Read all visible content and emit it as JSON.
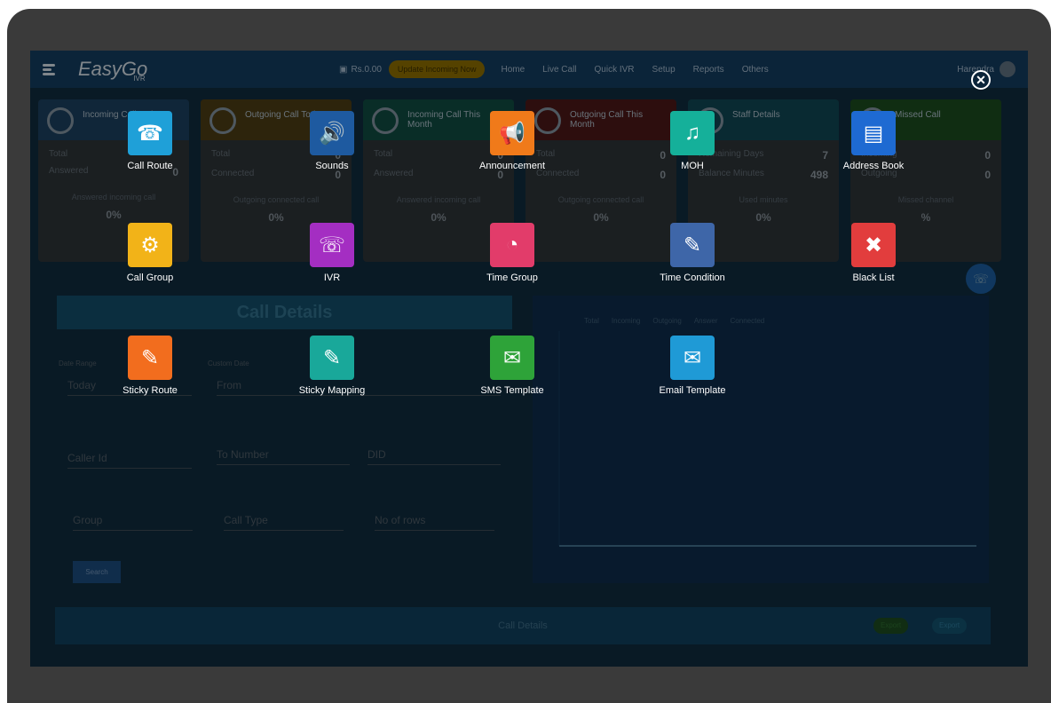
{
  "app": {
    "logo_text": "EasyGo",
    "logo_sub": "IVR",
    "balance": "Rs.0.00",
    "renew_label": "Update Incoming Now",
    "nav": [
      "Home",
      "Live Call",
      "Quick IVR",
      "Setup",
      "Reports",
      "Others"
    ],
    "user": "Harendra"
  },
  "cards": [
    {
      "title": "Incoming Call Today",
      "rows": [
        [
          "Total",
          ""
        ],
        [
          "Answered",
          "0"
        ]
      ],
      "sub": "Answered incoming call",
      "pct": "0%"
    },
    {
      "title": "Outgoing Call Today",
      "rows": [
        [
          "Total",
          "0"
        ],
        [
          "Connected",
          "0"
        ]
      ],
      "sub": "Outgoing connected call",
      "pct": "0%"
    },
    {
      "title": "Incoming Call This Month",
      "rows": [
        [
          "Total",
          "0"
        ],
        [
          "Answered",
          "0"
        ]
      ],
      "sub": "Answered incoming call",
      "pct": "0%"
    },
    {
      "title": "Outgoing Call This Month",
      "rows": [
        [
          "Total",
          "0"
        ],
        [
          "Connected",
          "0"
        ]
      ],
      "sub": "Outgoing connected call",
      "pct": "0%"
    },
    {
      "title": "Staff Details",
      "rows": [
        [
          "Remaining Days",
          "7"
        ],
        [
          "Balance Minutes",
          "498"
        ]
      ],
      "sub": "Used minutes",
      "pct": "0%"
    },
    {
      "title": "Missed Call",
      "rows": [
        [
          "Incoming",
          "0"
        ],
        [
          "Outgoing",
          "0"
        ]
      ],
      "sub": "Missed channel",
      "pct": "%"
    }
  ],
  "main": {
    "call_details_title": "Call Details",
    "date_range_label": "Date Range",
    "date_range_value": "Today",
    "from_label": "Custom Date",
    "from_value": "From",
    "caller_id": "Caller Id",
    "to_number": "To Number",
    "did": "DID",
    "group": "Group",
    "call_type": "Call Type",
    "rows": "No of rows",
    "search": "Search",
    "bottom_title": "Call Details",
    "export_excel": "Export",
    "export_pdf": "Export"
  },
  "legend": [
    "Total",
    "Incoming",
    "Outgoing",
    "Answer",
    "Connected"
  ],
  "modal": {
    "close_icon": "close-icon",
    "tiles": [
      {
        "label": "Call Route",
        "icon": "call-route-icon",
        "color": "#1fa0d8"
      },
      {
        "label": "Sounds",
        "icon": "speaker-icon",
        "color": "#1e5aa0"
      },
      {
        "label": "Announcement",
        "icon": "megaphone-icon",
        "color": "#f07a1a"
      },
      {
        "label": "MOH",
        "icon": "music-note-icon",
        "color": "#15b09a"
      },
      {
        "label": "Address Book",
        "icon": "address-book-icon",
        "color": "#1e6ad2"
      },
      {
        "label": "Call Group",
        "icon": "call-group-icon",
        "color": "#f2b318"
      },
      {
        "label": "IVR",
        "icon": "ivr-icon",
        "color": "#a42ec2"
      },
      {
        "label": "Time Group",
        "icon": "time-group-icon",
        "color": "#e23c6a"
      },
      {
        "label": "Time Condition",
        "icon": "time-condition-icon",
        "color": "#3e66a8"
      },
      {
        "label": "Black List",
        "icon": "blacklist-icon",
        "color": "#e23d3d"
      },
      {
        "label": "Sticky Route",
        "icon": "sticky-route-icon",
        "color": "#f26d1e"
      },
      {
        "label": "Sticky Mapping",
        "icon": "sticky-mapping-icon",
        "color": "#19a89a"
      },
      {
        "label": "SMS Template",
        "icon": "sms-template-icon",
        "color": "#2ea339"
      },
      {
        "label": "Email Template",
        "icon": "email-template-icon",
        "color": "#1f9ad6"
      }
    ]
  },
  "colors": {
    "card_heads": [
      "#1a3e5c",
      "#4a3a14",
      "#0f4a40",
      "#4a1818",
      "#0f4552",
      "#1b4a1e"
    ]
  }
}
